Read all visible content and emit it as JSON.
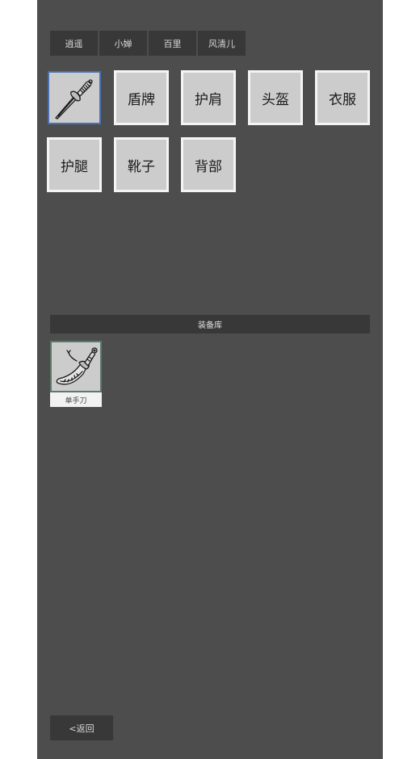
{
  "tabs": [
    {
      "label": "逍遥"
    },
    {
      "label": "小婵"
    },
    {
      "label": "百里"
    },
    {
      "label": "风清儿"
    }
  ],
  "slots": {
    "weapon": {
      "icon": "sword-icon"
    },
    "shield": {
      "label": "盾牌"
    },
    "shoulder": {
      "label": "护肩"
    },
    "helmet": {
      "label": "头盔"
    },
    "clothes": {
      "label": "衣服"
    },
    "legs": {
      "label": "护腿"
    },
    "boots": {
      "label": "靴子"
    },
    "back": {
      "label": "背部"
    }
  },
  "library": {
    "title": "装备库",
    "items": [
      {
        "label": "单手刀",
        "icon": "saber-icon"
      }
    ]
  },
  "back_button": {
    "label": "<返回"
  },
  "colors": {
    "panel": "#4d4d4d",
    "button": "#383838",
    "slot": "#cccccc",
    "selected_border": "#4a6fb3"
  }
}
